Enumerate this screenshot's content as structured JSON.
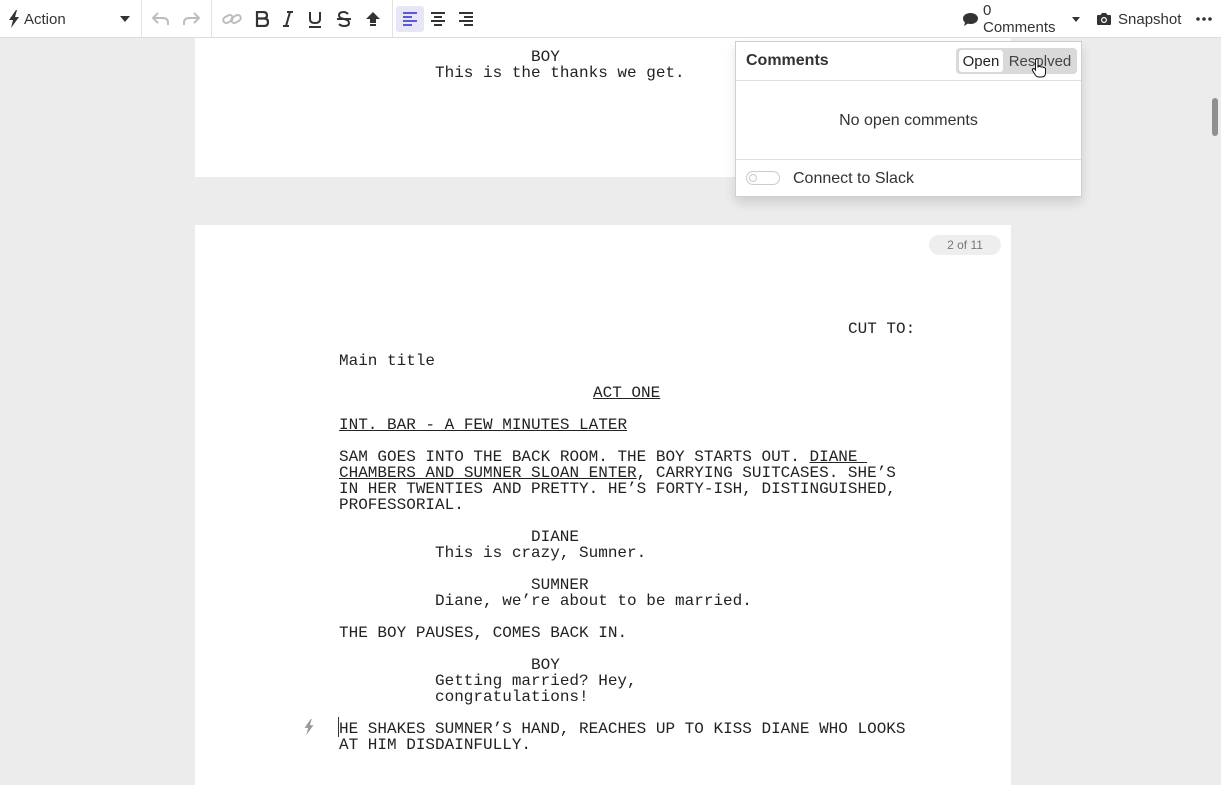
{
  "toolbar": {
    "element_type": "Action",
    "comments_label": "0 Comments",
    "snapshot_label": "Snapshot",
    "icons": [
      "bolt-icon",
      "caret-down-icon",
      "undo-icon",
      "redo-icon",
      "link-icon",
      "bold-icon",
      "italic-icon",
      "underline-icon",
      "strikethrough-icon",
      "uppercase-icon",
      "align-left-icon",
      "align-center-icon",
      "align-right-icon",
      "comment-icon",
      "camera-icon",
      "more-icon"
    ],
    "accent_color": "#5a5ad6"
  },
  "comments_panel": {
    "title": "Comments",
    "tabs": [
      {
        "label": "Open",
        "selected": true
      },
      {
        "label": "Resolved",
        "selected": false
      }
    ],
    "empty_message": "No open comments",
    "slack_label": "Connect to Slack",
    "slack_enabled": false
  },
  "page1": {
    "character": "BOY",
    "dialogue": "This is the thanks we get."
  },
  "page2": {
    "page_indicator": "2 of 11",
    "transition": "CUT TO:",
    "main_title": "Main title",
    "act_heading": "ACT ONE",
    "scene_heading": "INT. BAR - A FEW MINUTES LATER",
    "action1": {
      "line1_pre": "SAM GOES INTO THE BACK ROOM. THE BOY STARTS OUT. ",
      "line1_underlined": "DIANE ",
      "line2_underlined": "CHAMBERS AND SUMNER SLOAN ENTER",
      "line2_post": ", CARRYING SUITCASES. SHE’S",
      "line3": "IN HER TWENTIES AND PRETTY. HE’S FORTY-ISH, DISTINGUISHED,",
      "line4": "PROFESSORIAL."
    },
    "dialogue_blocks": [
      {
        "character": "DIANE",
        "lines": [
          "This is crazy, Sumner."
        ]
      },
      {
        "character": "SUMNER",
        "lines": [
          "Diane, we’re about to be married."
        ]
      },
      {
        "character": "BOY",
        "lines": [
          "Getting married? Hey,",
          "congratulations!"
        ]
      }
    ],
    "action2": "THE BOY PAUSES, COMES BACK IN.",
    "action3": {
      "line1": "HE SHAKES SUMNER’S HAND, REACHES UP TO KISS DIANE WHO LOOKS",
      "line2": "AT HIM DISDAINFULLY."
    }
  }
}
